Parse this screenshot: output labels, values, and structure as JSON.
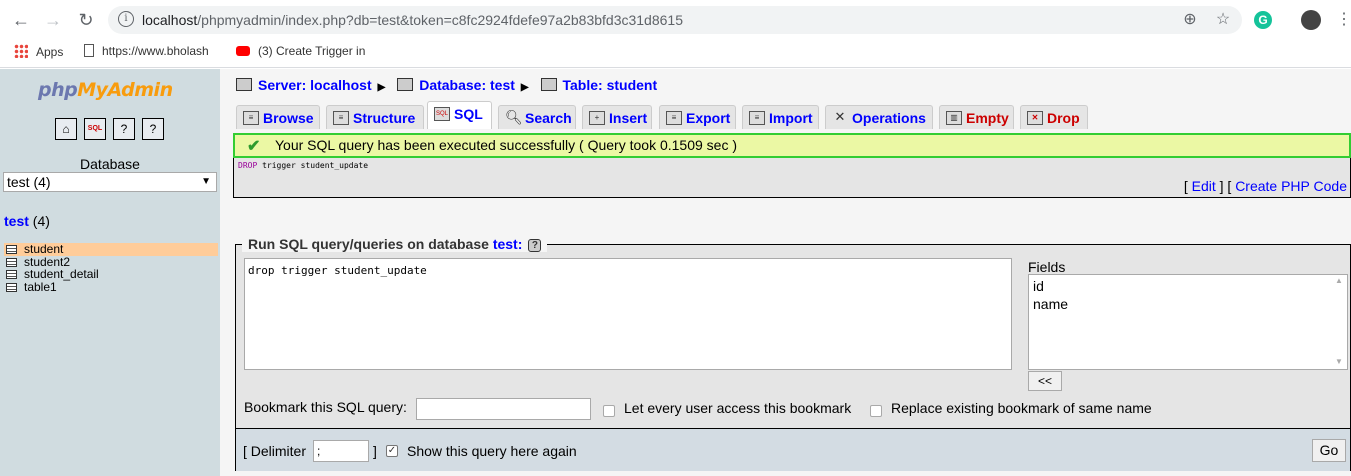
{
  "browser": {
    "url_host": "localhost",
    "url_path": "/phpmyadmin/index.php?db=test&token=c8fc2924fdefe97a2b83bfd3c31d8615",
    "bookmarks": [
      {
        "label": "Apps"
      },
      {
        "label": "https://www.bholash"
      },
      {
        "label": "(3) Create Trigger in"
      }
    ]
  },
  "sidebar": {
    "logo": {
      "php": "php",
      "my": "My",
      "admin": "Admin"
    },
    "db_label": "Database",
    "db_select_value": "test (4)",
    "db_title_name": "test",
    "db_title_count": "(4)",
    "tables": [
      "student",
      "student2",
      "student_detail",
      "table1"
    ]
  },
  "breadcrumb": {
    "server": "Server: localhost",
    "database": "Database: test",
    "table": "Table: student"
  },
  "tabs": [
    "Browse",
    "Structure",
    "SQL",
    "Search",
    "Insert",
    "Export",
    "Import",
    "Operations",
    "Empty",
    "Drop"
  ],
  "message": {
    "success": "Your SQL query has been executed successfully ( Query took 0.1509 sec )",
    "query_kw": "DROP",
    "query_rest": " trigger student_update",
    "edit_link": "Edit",
    "php_link": "Create PHP Code"
  },
  "query_form": {
    "legend_prefix": "Run SQL query/queries on database",
    "legend_db": "test:",
    "help_icon": "?",
    "textarea_value": "drop trigger student_update",
    "fields_label": "Fields",
    "fields": [
      "id",
      "name"
    ],
    "insert_button": "<<",
    "bookmark_label": "Bookmark this SQL query:",
    "bookmark_value": "",
    "every_user_label": "Let every user access this bookmark",
    "replace_label": "Replace existing bookmark of same name",
    "delimiter_label": "[ Delimiter",
    "delimiter_value": ";",
    "delimiter_close": "]",
    "show_again_label": "Show this query here again",
    "show_again_checked": true,
    "go_button": "Go"
  }
}
